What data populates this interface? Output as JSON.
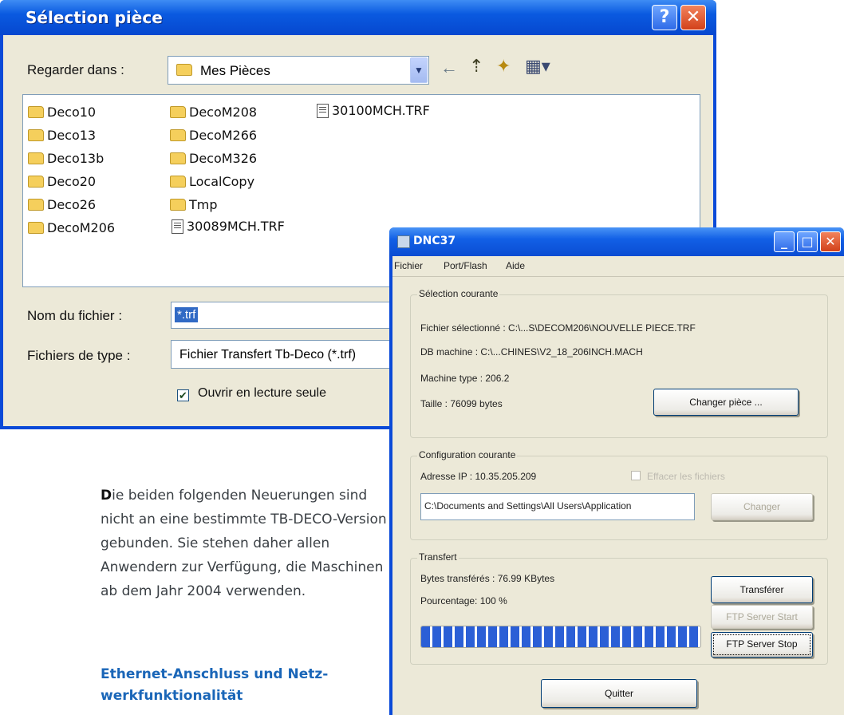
{
  "file_dialog": {
    "title": "Sélection pièce",
    "help_label": "?",
    "close_label": "✕",
    "look_in_label": "Regarder dans :",
    "look_in_value": "Mes Pièces",
    "files": [
      {
        "name": "Deco10",
        "type": "folder"
      },
      {
        "name": "Deco13",
        "type": "folder"
      },
      {
        "name": "Deco13b",
        "type": "folder"
      },
      {
        "name": "Deco20",
        "type": "folder"
      },
      {
        "name": "Deco26",
        "type": "folder"
      },
      {
        "name": "DecoM206",
        "type": "folder"
      },
      {
        "name": "DecoM208",
        "type": "folder"
      },
      {
        "name": "DecoM266",
        "type": "folder"
      },
      {
        "name": "DecoM326",
        "type": "folder"
      },
      {
        "name": "LocalCopy",
        "type": "folder"
      },
      {
        "name": "Tmp",
        "type": "folder"
      },
      {
        "name": "30089MCH.TRF",
        "type": "file"
      },
      {
        "name": "30100MCH.TRF",
        "type": "file"
      }
    ],
    "filename_label": "Nom du fichier :",
    "filename_value": "*.trf",
    "filetype_label": "Fichiers de type :",
    "filetype_value": "Fichier Transfert Tb-Deco (*.trf)",
    "readonly_label": "Ouvrir en lecture seule",
    "readonly_checked": true
  },
  "article": {
    "lead_letter": "D",
    "paragraph": "ie beiden folgenden Neuerungen sind nicht an eine bestimmte TB-DECO-Version gebunden. Sie stehen daher allen Anwendern zur Verfügung, die Maschinen ab dem Jahr 2004 verwenden.",
    "heading": "Ethernet-Anschluss und Netz-werkfunktionalität"
  },
  "dnc_window": {
    "title": "DNC37",
    "menu": [
      "Fichier",
      "Port/Flash",
      "Aide"
    ],
    "current_selection": {
      "title": "Sélection courante",
      "file": "Fichier sélectionné : C:\\...S\\DECOM206\\NOUVELLE PIECE.TRF",
      "db_machine": "DB machine : C:\\...CHINES\\V2_18_206INCH.MACH",
      "machine_type": "Machine type : 206.2",
      "size": "Taille :   76099 bytes",
      "change_button": "Changer pièce ..."
    },
    "current_config": {
      "title": "Configuration courante",
      "ip": "Adresse IP :   10.35.205.209",
      "clear_files": "Effacer les fichiers",
      "path": "C:\\Documents and Settings\\All Users\\Application",
      "change_button": "Changer"
    },
    "transfer": {
      "title": "Transfert",
      "bytes": "Bytes transférés : 76.99 KBytes",
      "percent": "Pourcentage: 100 %",
      "progress": 1.0,
      "transfer_button": "Transférer",
      "ftp_start_button": "FTP Server Start",
      "ftp_stop_button": "FTP Server Stop"
    },
    "quit_button": "Quitter"
  },
  "colors": {
    "xp_blue": "#0a4ad8",
    "dialog_face": "#ece9d8",
    "heading_blue": "#1a66b8",
    "progress_blue": "#2b5fd6"
  }
}
